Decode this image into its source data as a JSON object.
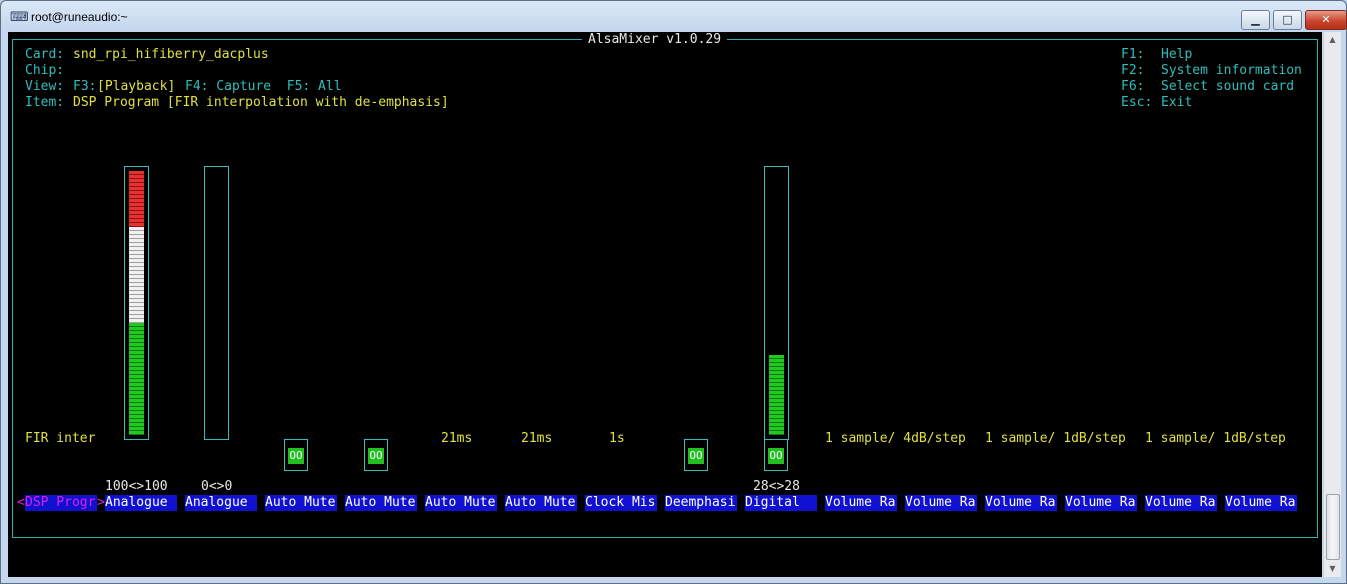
{
  "window": {
    "title": "root@runeaudio:~",
    "icon": "putty-icon",
    "buttons": {
      "minimize": "▁",
      "maximize": "□",
      "close": "✕"
    }
  },
  "mixer": {
    "title": "AlsaMixer v1.0.29",
    "card_label": "Card:",
    "card_value": "snd_rpi_hifiberry_dacplus",
    "chip_label": "Chip:",
    "chip_value": "",
    "view_label": "View:",
    "view_f3": "F3:",
    "view_playback": "[Playback]",
    "view_rest": "F4: Capture  F5: All",
    "item_label": "Item:",
    "item_value": "DSP Program [FIR interpolation with de-emphasis]",
    "help": [
      {
        "key": "F1:",
        "text": "Help"
      },
      {
        "key": "F2:",
        "text": "System information"
      },
      {
        "key": "F6:",
        "text": "Select sound card"
      },
      {
        "key": "Esc:",
        "text": "Exit"
      }
    ],
    "enum_values": {
      "dsp": "FIR inter",
      "auto_mute_time_l": "21ms",
      "auto_mute_time_r": "21ms",
      "clock_missing": "1s",
      "volume_ramp_1": "1 sample/ 4dB/step",
      "volume_ramp_2": "1 sample/ 1dB/step",
      "volume_ramp_3": "1 sample/ 1dB/step"
    },
    "switch_glyph": "OO",
    "levels": {
      "analogue_1": "100<>100",
      "analogue_2": "0<>0",
      "digital": "28<>28"
    },
    "level_fractions": {
      "analogue_1": 1.0,
      "analogue_2": 0.0,
      "digital": 0.3
    },
    "focused_control": {
      "left": "<",
      "name": "DSP Progr",
      "right": ">"
    },
    "controls": [
      "Analogue",
      "Analogue",
      "Auto Mute",
      "Auto Mute",
      "Auto Mute",
      "Auto Mute",
      "Clock Mis",
      "Deemphasi",
      "Digital",
      "Volume Ra",
      "Volume Ra",
      "Volume Ra",
      "Volume Ra",
      "Volume Ra",
      "Volume Ra"
    ],
    "colors": {
      "frame": "#2fbdbd",
      "label": "#2fbdbd",
      "value": "#e0e040",
      "control_bg": "#1010d0",
      "focus": "#e020e0",
      "meter_green": "#22c822",
      "meter_white": "#f0f0f0",
      "meter_red": "#e83030"
    }
  }
}
